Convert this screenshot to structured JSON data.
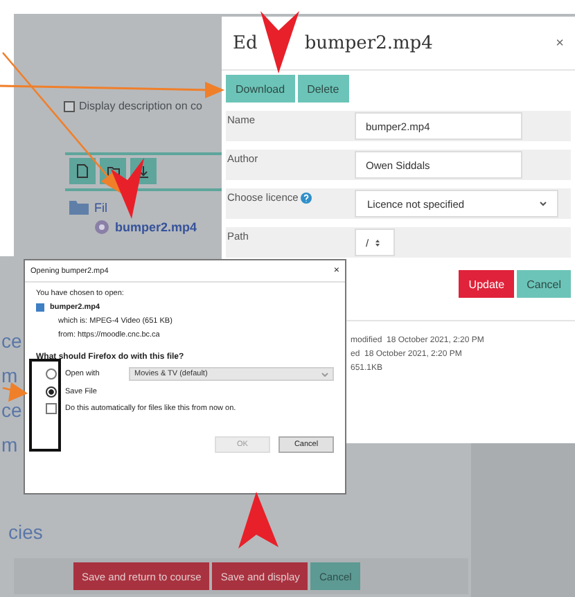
{
  "page": {
    "description_checkbox": {
      "label": "Display description on co",
      "checked": false
    },
    "file_tree": {
      "folder": "Fil",
      "file": "bumper2.mp4"
    },
    "link_fragments": [
      "ce",
      "m",
      "ce",
      "m"
    ],
    "section_link": "cies",
    "buttons": [
      {
        "label": "Save and return to course",
        "kind": "primary"
      },
      {
        "label": "Save and display",
        "kind": "primary"
      },
      {
        "label": "Cancel",
        "kind": "secondary"
      }
    ]
  },
  "edit_dialog": {
    "title_start": "Ed",
    "title_end": "bumper2.mp4",
    "close": "×",
    "actions": [
      {
        "label": "Download"
      },
      {
        "label": "Delete"
      }
    ],
    "fields": [
      {
        "label": "Name",
        "kind": "text",
        "value": "bumper2.mp4"
      },
      {
        "label": "Author",
        "kind": "text",
        "value": "Owen Siddals"
      },
      {
        "label": "Choose licence",
        "kind": "select",
        "value": "Licence not specified",
        "help": true
      },
      {
        "label": "Path",
        "kind": "path",
        "value": "/"
      }
    ],
    "buttons": [
      {
        "label": "Update",
        "kind": "primary"
      },
      {
        "label": "Cancel",
        "kind": "secondary"
      }
    ],
    "details": [
      "modified  18 October 2021, 2:20 PM",
      "ed  18 October 2021, 2:20 PM",
      "651.1KB"
    ]
  },
  "firefox_dialog": {
    "title": "Opening bumper2.mp4",
    "close": "×",
    "intro": "You have chosen to open:",
    "file": "bumper2.mp4",
    "type_line": "which is: MPEG-4 Video (651 KB)",
    "from_line": "from: https://moodle.cnc.bc.ca",
    "question": "What should Firefox do with this file?",
    "options": [
      {
        "label": "Open with",
        "selected": false,
        "app": "Movies & TV (default)"
      },
      {
        "label": "Save File",
        "selected": true
      }
    ],
    "auto": {
      "label": "Do this automatically for files like this from now on.",
      "checked": false
    },
    "buttons": [
      {
        "label": "OK",
        "disabled": true
      },
      {
        "label": "Cancel",
        "disabled": false
      }
    ]
  }
}
